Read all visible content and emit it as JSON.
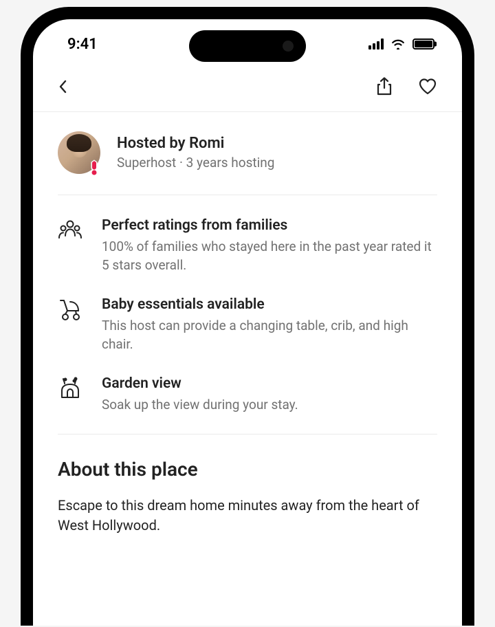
{
  "status": {
    "time": "9:41"
  },
  "host": {
    "title": "Hosted by Romi",
    "subtitle": "Superhost · 3 years hosting"
  },
  "highlights": [
    {
      "icon": "people-icon",
      "title": "Perfect ratings from families",
      "desc": "100% of families who stayed here in the past year rated it 5 stars overall."
    },
    {
      "icon": "stroller-icon",
      "title": "Baby essentials available",
      "desc": "This host can provide a changing table, crib, and high chair."
    },
    {
      "icon": "garden-icon",
      "title": "Garden view",
      "desc": "Soak up the view during your stay."
    }
  ],
  "about": {
    "heading": "About this place",
    "body": "Escape to this dream home minutes away from the heart of West Hollywood."
  }
}
